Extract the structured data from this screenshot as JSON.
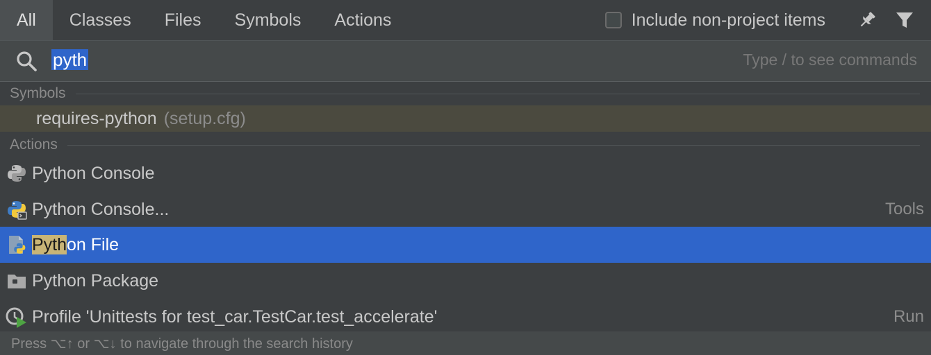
{
  "tabs": [
    {
      "label": "All",
      "active": true
    },
    {
      "label": "Classes",
      "active": false
    },
    {
      "label": "Files",
      "active": false
    },
    {
      "label": "Symbols",
      "active": false
    },
    {
      "label": "Actions",
      "active": false
    }
  ],
  "options": {
    "include_non_project_label": "Include non-project items",
    "include_non_project_checked": false
  },
  "search": {
    "value": "pyth",
    "hint": "Type / to see commands"
  },
  "sections": {
    "symbols": "Symbols",
    "actions": "Actions"
  },
  "symbols": [
    {
      "label": "requires-python",
      "hint": "(setup.cfg)"
    }
  ],
  "actions": [
    {
      "label": "Python Console",
      "right": "",
      "icon": "python-icon"
    },
    {
      "label": "Python Console...",
      "right": "Tools",
      "icon": "python-console-icon"
    },
    {
      "label_match": "Pyth",
      "label_rest": "on File",
      "right": "",
      "icon": "python-file-icon",
      "selected": true
    },
    {
      "label": "Python Package",
      "right": "",
      "icon": "folder-package-icon"
    },
    {
      "label": "Profile 'Unittests for test_car.TestCar.test_accelerate'",
      "right": "Run",
      "icon": "profile-run-icon"
    }
  ],
  "footer": {
    "text": "Press ⌥↑ or ⌥↓ to navigate through the search history"
  },
  "colors": {
    "selection": "#2f65ca",
    "symbol_highlight": "#4b4a3f",
    "match_highlight": "#c9b576"
  }
}
